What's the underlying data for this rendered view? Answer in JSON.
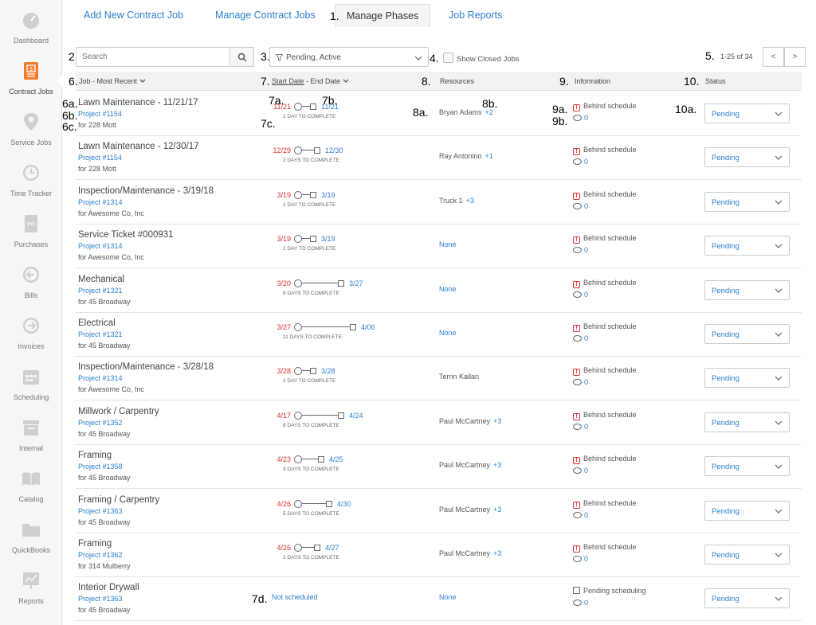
{
  "sidebar": {
    "items": [
      {
        "label": "Dashboard",
        "icon": "speedometer-icon",
        "active": false
      },
      {
        "label": "Contract Jobs",
        "icon": "contract-document-icon",
        "active": true
      },
      {
        "label": "Service Jobs",
        "icon": "map-pin-icon",
        "active": false
      },
      {
        "label": "Time Tracker",
        "icon": "clock-icon",
        "active": false
      },
      {
        "label": "Purchases",
        "icon": "purchase-order-icon",
        "active": false
      },
      {
        "label": "Bills",
        "icon": "arrow-left-circle-icon",
        "active": false
      },
      {
        "label": "Invoices",
        "icon": "arrow-right-circle-icon",
        "active": false
      },
      {
        "label": "Scheduling",
        "icon": "calendar-icon",
        "active": false
      },
      {
        "label": "Internal",
        "icon": "archive-box-icon",
        "active": false
      },
      {
        "label": "Catalog",
        "icon": "open-book-icon",
        "active": false
      },
      {
        "label": "QuickBooks",
        "icon": "folder-icon",
        "active": false
      },
      {
        "label": "Reports",
        "icon": "chart-board-icon",
        "active": false
      }
    ]
  },
  "tabs": [
    {
      "label": "Add New Contract Job"
    },
    {
      "label": "Manage Contract Jobs"
    },
    {
      "label": "Manage Phases",
      "active": true
    },
    {
      "label": "Job Reports"
    }
  ],
  "annotations": {
    "tab": "1.",
    "search": "2.",
    "filter": "3.",
    "closed": "4.",
    "pager": "5.",
    "job": "6.",
    "dates": "7.",
    "resources": "8.",
    "information": "9.",
    "status": "10.",
    "title": "6a.",
    "project": "6b.",
    "for": "6c.",
    "start": "7a.",
    "end": "7b.",
    "days": "7c.",
    "notsched": "7d.",
    "resource": "8a.",
    "more": "8b.",
    "alert": "9a.",
    "comments": "9b.",
    "statusval": "10a."
  },
  "toolbar": {
    "search_placeholder": "Search",
    "filter_value": "Pending, Active",
    "show_closed_label": "Show Closed Jobs",
    "page_count": "1-25 of 34",
    "prev": "<",
    "next": ">"
  },
  "columns": {
    "job": "Job - Most Recent",
    "start_date": "Start Date",
    "date_sep": " - ",
    "end_date": "End Date",
    "resources": "Resources",
    "information": "Information",
    "status": "Status"
  },
  "rows": [
    {
      "title": "Lawn Maintenance - 11/21/17",
      "project": "Project #1154",
      "for": "for 228 Mott",
      "start": "11/21",
      "end": "11/21",
      "days": "1 DAY TO COMPLETE",
      "span_days": 1,
      "resource": "Bryan Adams",
      "more": "+2",
      "info": "Behind schedule",
      "info_type": "alert",
      "comments": "0",
      "status": "Pending"
    },
    {
      "title": "Lawn Maintenance - 12/30/17",
      "project": "Project #1154",
      "for": "for 228 Mott",
      "start": "12/29",
      "end": "12/30",
      "days": "2 DAYS TO COMPLETE",
      "span_days": 2,
      "resource": "Ray Antonino",
      "more": "+1",
      "info": "Behind schedule",
      "info_type": "alert",
      "comments": "0",
      "status": "Pending"
    },
    {
      "title": "Inspection/Maintenance - 3/19/18",
      "project": "Project #1314",
      "for": "for Awesome Co, Inc",
      "start": "3/19",
      "end": "3/19",
      "days": "1 DAY TO COMPLETE",
      "span_days": 1,
      "resource": "Truck 1",
      "more": "+3",
      "info": "Behind schedule",
      "info_type": "alert",
      "comments": "0",
      "status": "Pending"
    },
    {
      "title": "Service Ticket #000931",
      "project": "Project #1314",
      "for": "for Awesome Co, Inc",
      "start": "3/19",
      "end": "3/19",
      "days": "1 DAY TO COMPLETE",
      "span_days": 1,
      "resource": "None",
      "more": "",
      "info": "Behind schedule",
      "info_type": "alert",
      "comments": "0",
      "status": "Pending"
    },
    {
      "title": "Mechanical",
      "project": "Project #1321",
      "for": "for 45 Broadway",
      "start": "3/20",
      "end": "3/27",
      "days": "8 DAYS TO COMPLETE",
      "span_days": 8,
      "resource": "None",
      "more": "",
      "info": "Behind schedule",
      "info_type": "alert",
      "comments": "0",
      "status": "Pending"
    },
    {
      "title": "Electrical",
      "project": "Project #1321",
      "for": "for 45 Broadway",
      "start": "3/27",
      "end": "4/06",
      "days": "11 DAYS TO COMPLETE",
      "span_days": 11,
      "resource": "None",
      "more": "",
      "info": "Behind schedule",
      "info_type": "alert",
      "comments": "0",
      "status": "Pending"
    },
    {
      "title": "Inspection/Maintenance - 3/28/18",
      "project": "Project #1314",
      "for": "for Awesome Co, Inc",
      "start": "3/28",
      "end": "3/28",
      "days": "1 DAY TO COMPLETE",
      "span_days": 1,
      "resource": "Terrin Kallan",
      "more": "",
      "info": "Behind schedule",
      "info_type": "alert",
      "comments": "0",
      "status": "Pending"
    },
    {
      "title": "Millwork / Carpentry",
      "project": "Project #1352",
      "for": "for 45 Broadway",
      "start": "4/17",
      "end": "4/24",
      "days": "8 DAYS TO COMPLETE",
      "span_days": 8,
      "resource": "Paul McCartney",
      "more": "+3",
      "info": "Behind schedule",
      "info_type": "alert",
      "comments": "0",
      "status": "Pending"
    },
    {
      "title": "Framing",
      "project": "Project #1358",
      "for": "for 45 Broadway",
      "start": "4/23",
      "end": "4/25",
      "days": "3 DAYS TO COMPLETE",
      "span_days": 3,
      "resource": "Paul McCartney",
      "more": "+3",
      "info": "Behind schedule",
      "info_type": "alert",
      "comments": "0",
      "status": "Pending"
    },
    {
      "title": "Framing / Carpentry",
      "project": "Project #1363",
      "for": "for 45 Broadway",
      "start": "4/26",
      "end": "4/30",
      "days": "5 DAYS TO COMPLETE",
      "span_days": 5,
      "resource": "Paul McCartney",
      "more": "+3",
      "info": "Behind schedule",
      "info_type": "alert",
      "comments": "0",
      "status": "Pending"
    },
    {
      "title": "Framing",
      "project": "Project #1362",
      "for": "for 314 Mulberry",
      "start": "4/26",
      "end": "4/27",
      "days": "2 DAYS TO COMPLETE",
      "span_days": 2,
      "resource": "Paul McCartney",
      "more": "+3",
      "info": "Behind schedule",
      "info_type": "alert",
      "comments": "0",
      "status": "Pending"
    },
    {
      "title": "Interior Drywall",
      "project": "Project #1363",
      "for": "for 45 Broadway",
      "not_scheduled": "Not scheduled",
      "resource": "None",
      "more": "",
      "info": "Pending scheduling",
      "info_type": "calendar",
      "comments": "0",
      "status": "Pending"
    }
  ],
  "colors": {
    "accent": "#2a7fcf",
    "overdue": "#e03131",
    "active_nav": "#f07c2a"
  }
}
